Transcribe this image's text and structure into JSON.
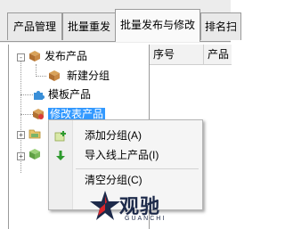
{
  "tabs": [
    {
      "label": "产品管理",
      "active": false
    },
    {
      "label": "批量重发",
      "active": false
    },
    {
      "label": "批量发布与修改",
      "active": true
    },
    {
      "label": "排名扫",
      "active": false
    }
  ],
  "tree": {
    "nodes": [
      {
        "label": "发布产品",
        "icon": "box-icon",
        "expand": "-"
      },
      {
        "label": "新建分组",
        "icon": "box-icon"
      },
      {
        "label": "模板产品",
        "icon": "puzzle-icon"
      },
      {
        "label": "修改表产品",
        "icon": "box-edit-icon",
        "selected": true
      },
      {
        "label": "",
        "icon": "folder-icon",
        "expand": "+"
      },
      {
        "label": "",
        "icon": "box-green-icon",
        "expand": "+"
      }
    ]
  },
  "grid": {
    "columns": [
      "序号",
      "产品"
    ]
  },
  "context_menu": {
    "items": [
      {
        "label": "添加分组(A)",
        "icon": "add-group-icon"
      },
      {
        "label": "导入线上产品(I)",
        "icon": "download-arrow-icon"
      },
      {
        "label": "清空分组(C)",
        "icon": ""
      }
    ]
  },
  "watermark": {
    "text": "观驰",
    "sub": "GUANCHI"
  },
  "colors": {
    "selection": "#3399ff",
    "watermark": "#1d2a4a",
    "watermark_star_red": "#d9262b"
  }
}
